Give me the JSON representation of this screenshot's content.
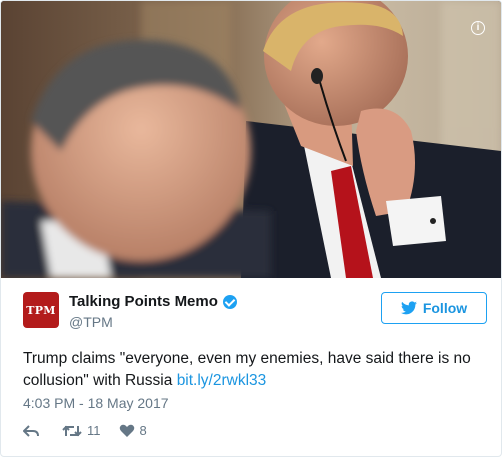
{
  "photo": {
    "info_icon": "info-icon",
    "info_glyph": "i"
  },
  "account": {
    "avatar_text": "TPM",
    "name": "Talking Points Memo",
    "handle": "@TPM",
    "verified_icon": "verified-badge-icon"
  },
  "follow_button": {
    "label": "Follow",
    "icon": "twitter-bird-icon"
  },
  "tweet": {
    "text": "Trump claims \"everyone, even my enemies, have said there is no collusion\" with Russia ",
    "link": "bit.ly/2rwkl33",
    "timestamp": "4:03 PM - 18 May 2017"
  },
  "actions": {
    "reply_icon": "reply-icon",
    "retweet_icon": "retweet-icon",
    "retweet_count": "11",
    "like_icon": "heart-icon",
    "like_count": "8"
  },
  "colors": {
    "twitter_blue": "#1da1f2",
    "link": "#1b95e0",
    "muted": "#657786",
    "tpm_red": "#b31b1b"
  }
}
